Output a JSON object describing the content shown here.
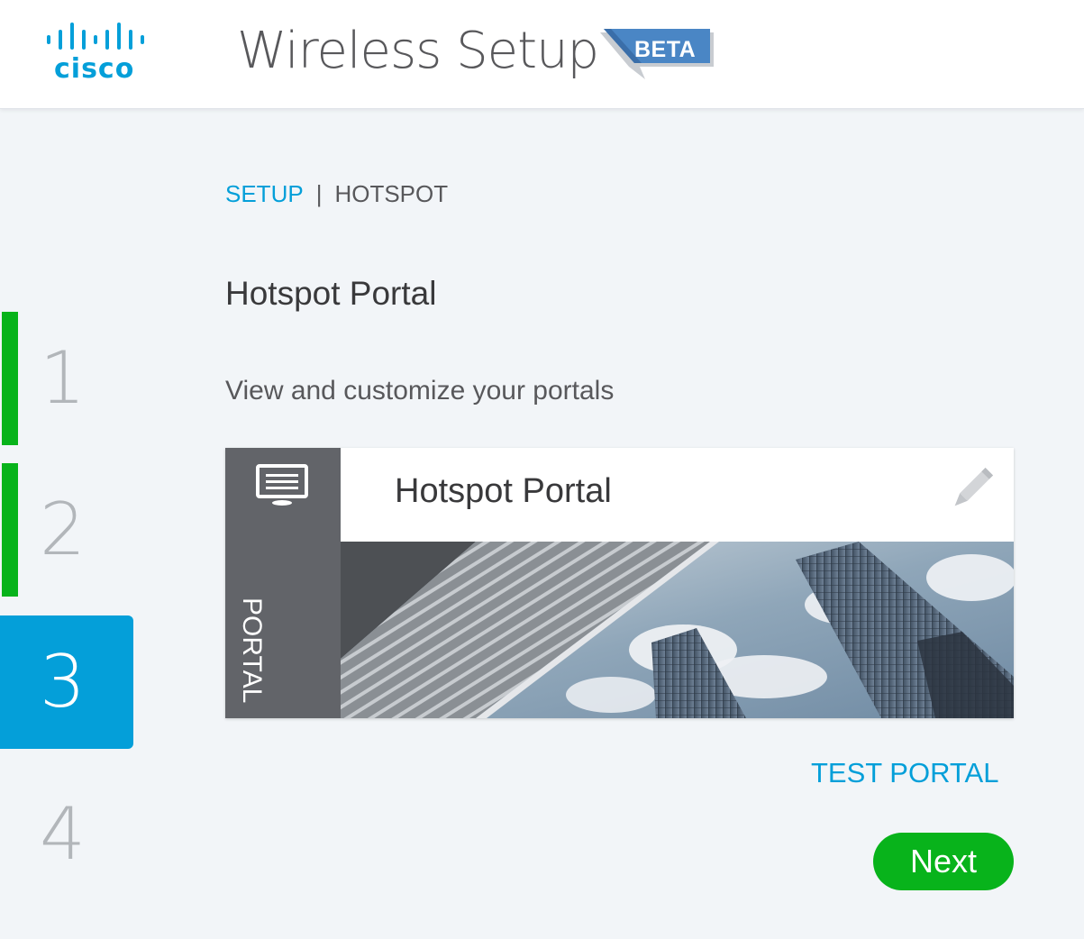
{
  "header": {
    "logo_text": "cisco",
    "app_title": "Wireless Setup",
    "badge": "BETA"
  },
  "steps": [
    {
      "number": "1",
      "state": "complete"
    },
    {
      "number": "2",
      "state": "complete"
    },
    {
      "number": "3",
      "state": "active"
    },
    {
      "number": "4",
      "state": "pending"
    }
  ],
  "breadcrumb": {
    "link": "SETUP",
    "separator": "|",
    "current": "HOTSPOT"
  },
  "main": {
    "title": "Hotspot Portal",
    "subtitle": "View and customize your portals"
  },
  "portal_card": {
    "side_label": "PORTAL",
    "title": "Hotspot Portal",
    "side_icon": "monitor-icon",
    "edit_icon": "pencil-icon"
  },
  "actions": {
    "test_portal": "TEST PORTAL",
    "next": "Next"
  },
  "colors": {
    "accent": "#049fd9",
    "success": "#08b31b",
    "background": "#f2f5f8",
    "card_side": "#626469"
  }
}
